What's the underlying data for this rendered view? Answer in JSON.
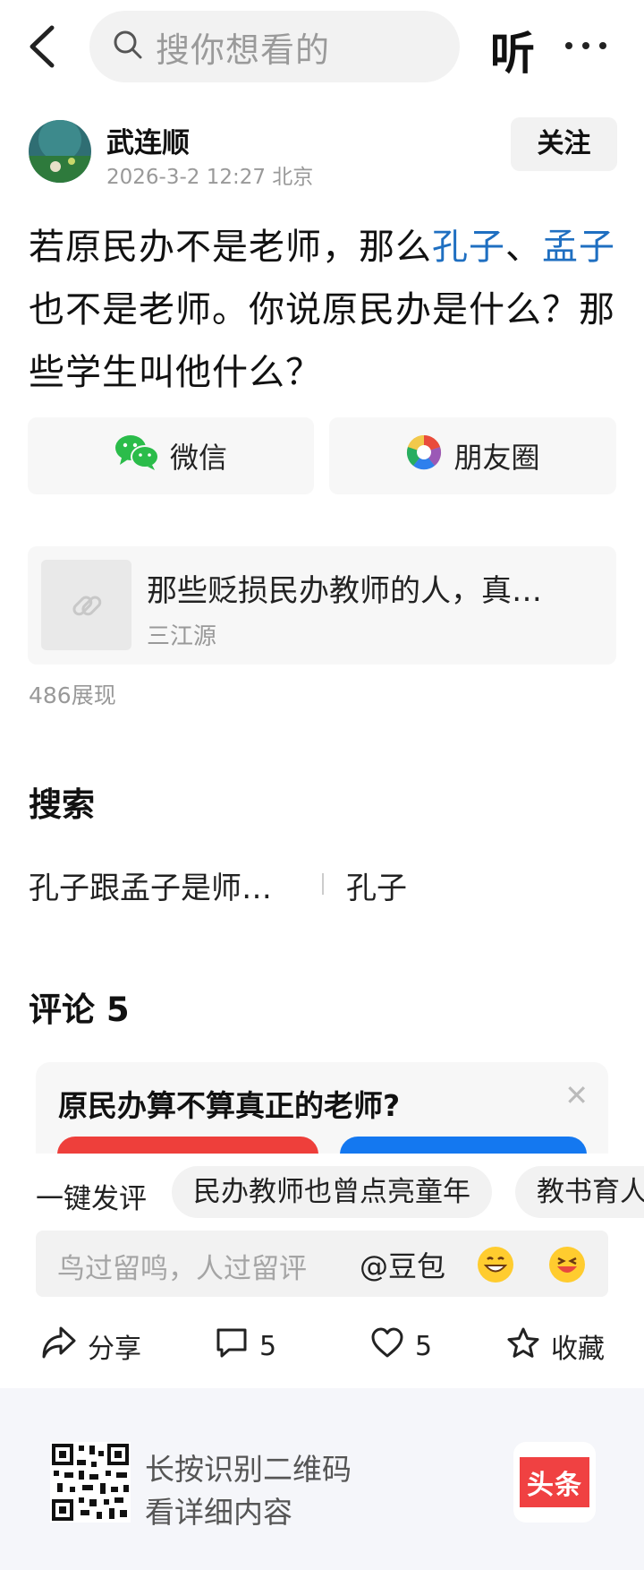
{
  "topbar": {
    "search_placeholder": "搜你想看的",
    "listen_label": "听"
  },
  "author": {
    "name": "武连顺",
    "meta": "2026-3-2 12:27 北京",
    "follow_label": "关注"
  },
  "article": {
    "part1": "若原民办不是老师，那么",
    "link1": "孔子",
    "sep": "、",
    "link2": "孟子",
    "part2": "也不是老师。你说原民办是什么？那些学生叫他什么？"
  },
  "share": {
    "wechat": "微信",
    "moments": "朋友圈"
  },
  "link_card": {
    "title": "那些贬损民办教师的人，真…",
    "source": "三江源"
  },
  "views": "486展现",
  "search_section": {
    "title": "搜索",
    "suggestions": [
      "孔子跟孟子是师…",
      "孔子"
    ]
  },
  "comments": {
    "title": "评论 5",
    "poll_question": "原民办算不算真正的老师?"
  },
  "quick_comment": {
    "label": "一键发评",
    "chips": [
      "民办教师也曾点亮童年",
      "教书育人"
    ]
  },
  "input": {
    "placeholder": "鸟过留鸣，人过留评",
    "doubao": "@豆包"
  },
  "actions": {
    "share": "分享",
    "comments": "5",
    "likes": "5",
    "favorite": "收藏"
  },
  "footer": {
    "line1": "长按识别二维码",
    "line2": "看详细内容",
    "brand": "头条"
  },
  "colors": {
    "link_blue": "#1f6fc1",
    "poll_red": "#ee3f3b",
    "poll_blue": "#1478f0",
    "brand_red": "#f04142"
  }
}
